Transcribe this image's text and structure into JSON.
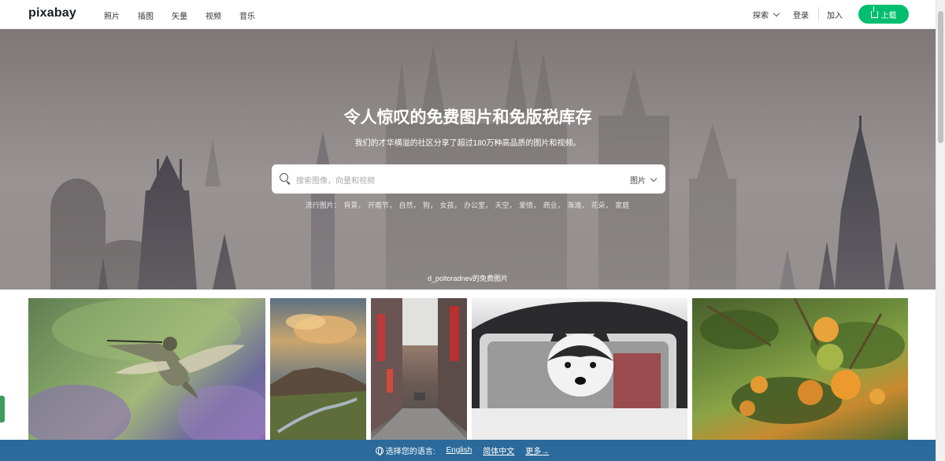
{
  "header": {
    "logo": "pixabay",
    "nav": [
      "照片",
      "插图",
      "矢量",
      "视频",
      "音乐"
    ],
    "explore_label": "探索",
    "login_label": "登录",
    "join_label": "加入",
    "upload_label": "上载",
    "upload_color": "#02be6e"
  },
  "hero": {
    "title": "令人惊叹的免费图片和免版税库存",
    "subtitle": "我们的才华横溢的社区分享了超过180万种高品质的图片和视频。",
    "search_placeholder": "搜索图像，向量和视频",
    "search_type": "图片",
    "tags_label": "流行图片：",
    "tags": [
      "背景，",
      "开斋节，",
      "自然，",
      "狗，",
      "女孩，",
      "办公室，",
      "天空，",
      "爱情，",
      "商业，",
      "海滩，",
      "花朵，",
      "家庭"
    ],
    "credit": "d_poltoradnev的免费图片"
  },
  "gallery": {
    "images": [
      "hummingbird-image",
      "mountain-landscape-image",
      "city-street-image",
      "husky-in-car-image",
      "orange-tree-image"
    ]
  },
  "language_bar": {
    "label": "选择您的语言:",
    "options": [
      "English",
      "简体中文",
      "更多→"
    ],
    "background": "#2b6a9a"
  }
}
